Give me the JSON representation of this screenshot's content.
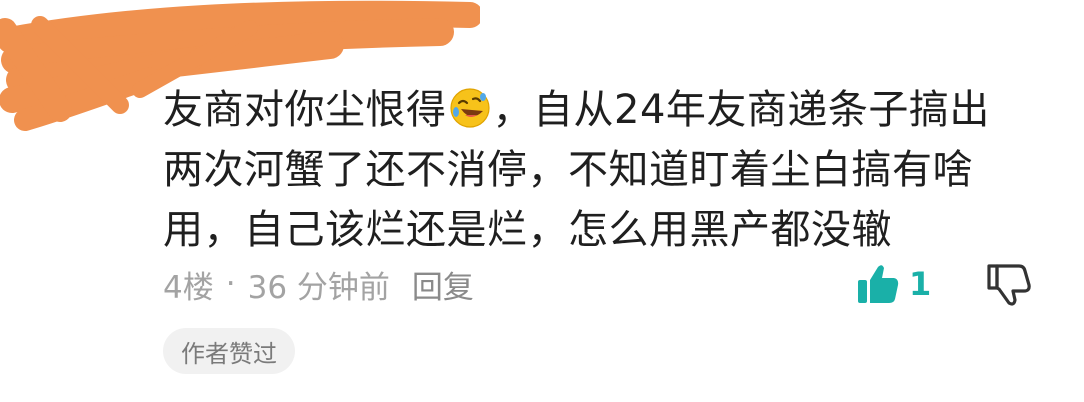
{
  "comment": {
    "lines": [
      "友商对你尘恨得",
      "，自从24年友商递条子搞出",
      "两次河蟹了还不消停，不知道盯着尘白搞有啥",
      "用，自己该烂还是烂，怎么用黑产都没辙"
    ],
    "emoji": "rolling-on-floor-laughing-emoji"
  },
  "meta": {
    "floor": "4楼",
    "separator": "·",
    "time": "36 分钟前",
    "reply_label": "回复"
  },
  "actions": {
    "like_count": "1",
    "like_icon": "thumbs-up-icon",
    "dislike_icon": "thumbs-down-icon"
  },
  "badge": {
    "label": "作者赞过"
  },
  "colors": {
    "redaction": "#f0914f",
    "accent": "#1ab0a8",
    "meta_text": "#a3a3a3",
    "badge_bg": "#f1f1f1"
  }
}
